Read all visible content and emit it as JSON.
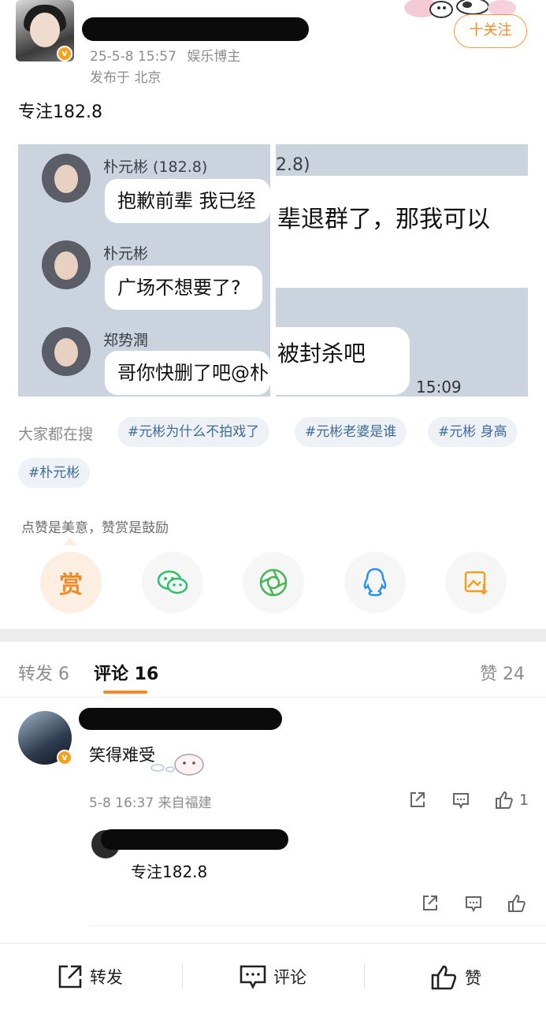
{
  "post": {
    "verified_badge": "v",
    "timestamp": "25-5-8 15:57",
    "author_tag": "娱乐博主",
    "location": "发布于 北京",
    "follow_label": "十关注",
    "text": "专注182.8"
  },
  "screenshot": {
    "left": {
      "messages": [
        {
          "name": "朴元彬 (182.8)",
          "text": "抱歉前辈 我已经"
        },
        {
          "name": "朴元彬",
          "text": "广场不想要了?"
        },
        {
          "name": "郑势潤",
          "text": "哥你快删了吧@朴"
        }
      ]
    },
    "right": {
      "header": "2.8)",
      "top_text": "辈退群了，那我可以",
      "bubble_text": "被封杀吧",
      "time": "15:09"
    }
  },
  "hot_search": {
    "label": "大家都在搜",
    "tags": [
      "#元彬为什么不拍戏了",
      "#元彬老婆是谁",
      "#元彬 身高",
      "#朴元彬"
    ]
  },
  "reward": {
    "text": "点赞是美意，赞赏是鼓励",
    "button_label": "赏"
  },
  "share_icons": [
    "wechat-icon",
    "moments-icon",
    "qq-icon",
    "save-image-icon"
  ],
  "tabs": {
    "repost": "转发 6",
    "comments": "评论 16",
    "likes": "赞 24"
  },
  "comment": {
    "text": "笑得难受",
    "meta": "5-8 16:37 来自福建",
    "like_count": "1",
    "reply": {
      "text": "专注182.8"
    }
  },
  "bottom_bar": {
    "repost": "转发",
    "comment": "评论",
    "like": "赞"
  },
  "colors": {
    "accent": "#f08a28",
    "tag_text": "#3f6a96",
    "tag_bg": "#eef2f7",
    "wechat_green": "#2fbf6a",
    "qq_blue": "#2b8ff0"
  }
}
